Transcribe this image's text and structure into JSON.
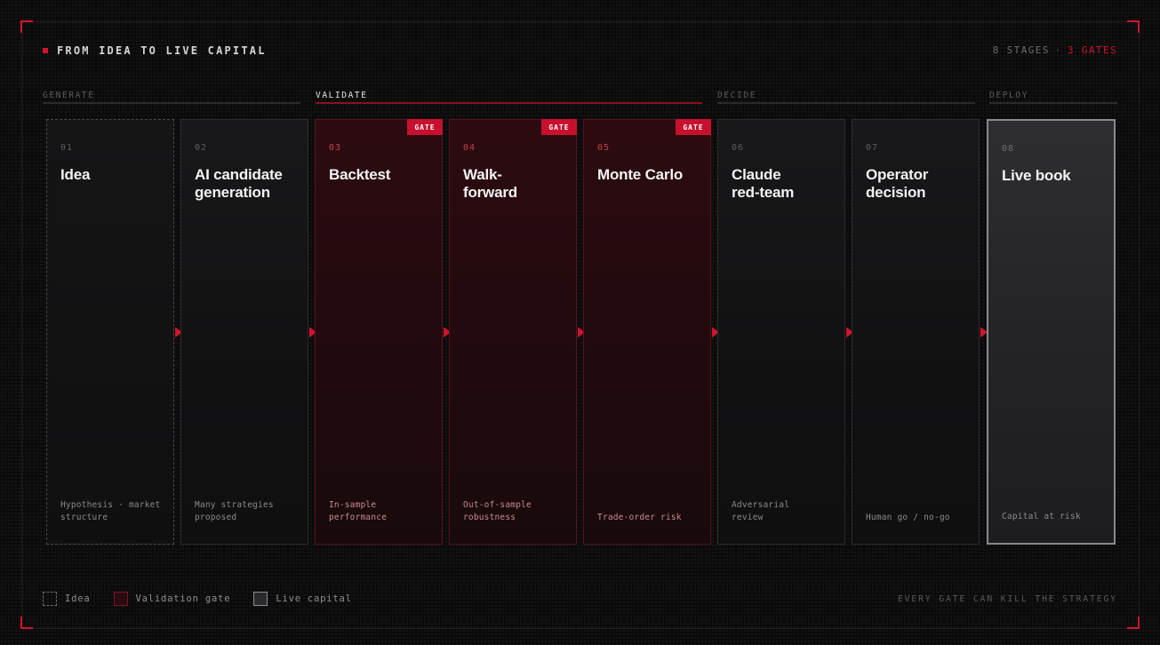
{
  "header": {
    "title": "FROM IDEA TO LIVE CAPITAL",
    "stages_count": "8 STAGES",
    "separator": "·",
    "gates_count": "3 GATES"
  },
  "phases": [
    {
      "label": "GENERATE",
      "active": false
    },
    {
      "label": "VALIDATE",
      "active": true
    },
    {
      "label": "DECIDE",
      "active": false
    },
    {
      "label": "DEPLOY",
      "active": false
    }
  ],
  "stages": [
    {
      "num": "01",
      "title": "Idea",
      "desc": "Hypothesis · market structure",
      "type": "idea"
    },
    {
      "num": "02",
      "title": "AI candidate generation",
      "desc": "Many strategies proposed",
      "type": "normal"
    },
    {
      "num": "03",
      "title": "Backtest",
      "desc": "In-sample performance",
      "type": "gate",
      "badge": "GATE"
    },
    {
      "num": "04",
      "title": "Walk-forward",
      "desc": "Out-of-sample robustness",
      "type": "gate",
      "badge": "GATE"
    },
    {
      "num": "05",
      "title": "Monte Carlo",
      "desc": "Trade-order risk",
      "type": "gate",
      "badge": "GATE"
    },
    {
      "num": "06",
      "title": "Claude red-team",
      "desc": "Adversarial review",
      "type": "normal"
    },
    {
      "num": "07",
      "title": "Operator decision",
      "desc": "Human go / no-go",
      "type": "normal"
    },
    {
      "num": "08",
      "title": "Live book",
      "desc": "Capital at risk",
      "type": "live"
    }
  ],
  "legend": [
    {
      "label": "Idea",
      "swatch": "dashed"
    },
    {
      "label": "Validation gate",
      "swatch": "gate"
    },
    {
      "label": "Live capital",
      "swatch": "live"
    }
  ],
  "footer": {
    "note": "EVERY GATE CAN KILL THE STRATEGY"
  },
  "colors": {
    "accent": "#d0142c",
    "gate_fill": "#2c0b10",
    "background": "#0b0b0c"
  }
}
